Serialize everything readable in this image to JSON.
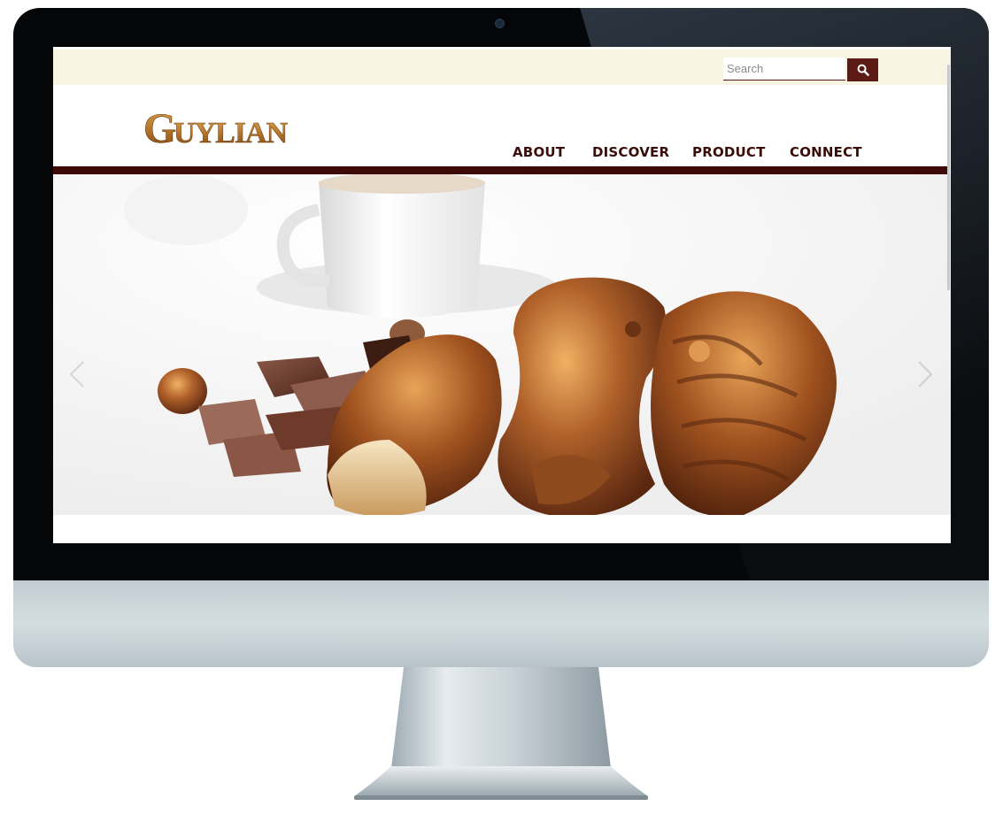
{
  "search": {
    "placeholder": "Search",
    "button_icon": "search-icon"
  },
  "brand": {
    "name": "Guylian",
    "logo_color": "#b5762a"
  },
  "nav": {
    "items": [
      {
        "label": "ABOUT"
      },
      {
        "label": "DISCOVER"
      },
      {
        "label": "PRODUCT"
      },
      {
        "label": "CONNECT"
      }
    ]
  },
  "hero": {
    "prev_icon": "chevron-left-icon",
    "next_icon": "chevron-right-icon"
  },
  "colors": {
    "topbar": "#f8f4e3",
    "accent": "#3d0a08",
    "search_button": "#5c1b14",
    "nav_text": "#3a0d0a"
  }
}
